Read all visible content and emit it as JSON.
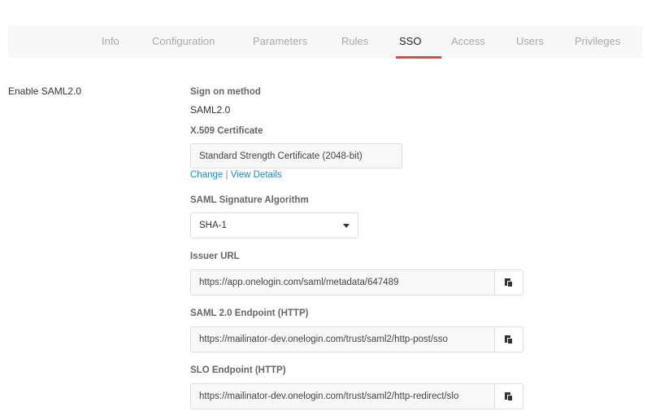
{
  "tabs": [
    {
      "label": "Info"
    },
    {
      "label": "Configuration"
    },
    {
      "label": "Parameters"
    },
    {
      "label": "Rules"
    },
    {
      "label": "SSO",
      "active": true
    },
    {
      "label": "Access"
    },
    {
      "label": "Users"
    },
    {
      "label": "Privileges"
    }
  ],
  "accent_color": "#e8454a",
  "section_title": "Enable SAML2.0",
  "sign_on": {
    "label": "Sign on method",
    "value": "SAML2.0"
  },
  "certificate": {
    "label": "X.509 Certificate",
    "value": "Standard Strength Certificate (2048-bit)",
    "change_link": "Change",
    "separator": "|",
    "details_link": "View Details"
  },
  "algorithm": {
    "label": "SAML Signature Algorithm",
    "value": "SHA-1"
  },
  "issuer": {
    "label": "Issuer URL",
    "value": "https://app.onelogin.com/saml/metadata/647489",
    "icon": "copy-icon"
  },
  "saml_endpoint": {
    "label": "SAML 2.0 Endpoint (HTTP)",
    "value": "https://mailinator-dev.onelogin.com/trust/saml2/http-post/sso",
    "icon": "copy-icon"
  },
  "slo_endpoint": {
    "label": "SLO Endpoint (HTTP)",
    "value": "https://mailinator-dev.onelogin.com/trust/saml2/http-redirect/slo",
    "icon": "copy-icon"
  }
}
